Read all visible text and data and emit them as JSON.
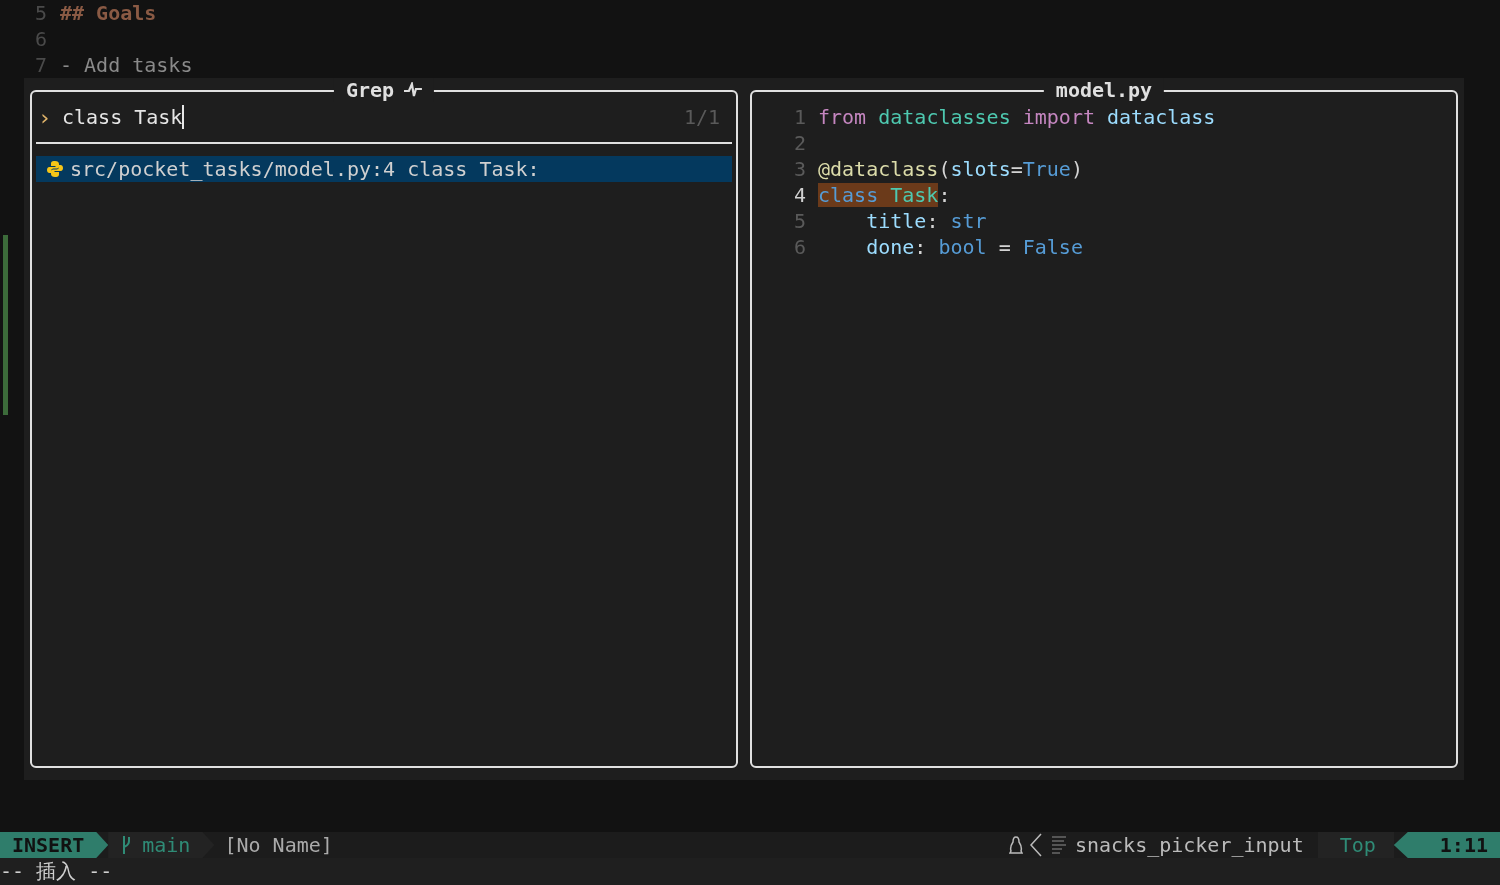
{
  "editor": {
    "lines": [
      {
        "number": "5",
        "kind": "heading",
        "text": "## Goals"
      },
      {
        "number": "6"
      },
      {
        "number": "7",
        "kind": "text",
        "text": "- Add tasks"
      }
    ]
  },
  "picker": {
    "title": "Grep",
    "prompt": "›",
    "query": "class Task",
    "count": "1/1",
    "results": [
      {
        "path": "src/pocket_tasks/model.py:4",
        "text": "class Task:",
        "selected": true
      }
    ]
  },
  "preview": {
    "title": "model.py",
    "lines": [
      {
        "number": "1",
        "current": false,
        "tokens": [
          {
            "text": "from ",
            "kind": "keyword",
            "match": false
          },
          {
            "text": "dataclasses ",
            "kind": "module",
            "match": false
          },
          {
            "text": "import ",
            "kind": "keyword",
            "match": false
          },
          {
            "text": "dataclass",
            "kind": "name",
            "match": false
          }
        ]
      },
      {
        "number": "2",
        "current": false
      },
      {
        "number": "3",
        "current": false,
        "tokens": [
          {
            "text": "@dataclass",
            "kind": "decorator",
            "match": false
          },
          {
            "text": "(",
            "kind": "plain",
            "match": false
          },
          {
            "text": "slots",
            "kind": "name",
            "match": false
          },
          {
            "text": "=",
            "kind": "plain",
            "match": false
          },
          {
            "text": "True",
            "kind": "constant",
            "match": false
          },
          {
            "text": ")",
            "kind": "plain",
            "match": false
          }
        ]
      },
      {
        "number": "4",
        "current": true,
        "tokens": [
          {
            "text": "class ",
            "kind": "constant",
            "match": true
          },
          {
            "text": "Task",
            "kind": "module",
            "match": true
          },
          {
            "text": ":",
            "kind": "plain",
            "match": false
          }
        ]
      },
      {
        "number": "5",
        "current": false,
        "indent": true,
        "tokens": [
          {
            "text": "title",
            "kind": "name",
            "match": false
          },
          {
            "text": ": ",
            "kind": "plain",
            "match": false
          },
          {
            "text": "str",
            "kind": "constant",
            "match": false
          }
        ]
      },
      {
        "number": "6",
        "current": false,
        "indent": true,
        "tokens": [
          {
            "text": "done",
            "kind": "name",
            "match": false
          },
          {
            "text": ": ",
            "kind": "plain",
            "match": false
          },
          {
            "text": "bool",
            "kind": "constant",
            "match": false
          },
          {
            "text": " = ",
            "kind": "plain",
            "match": false
          },
          {
            "text": "False",
            "kind": "constant",
            "match": false
          }
        ]
      }
    ]
  },
  "status_bar": {
    "mode": "INSERT",
    "branch": "main",
    "file": "[No Name]",
    "filetype": "snacks_picker_input",
    "position": "Top",
    "cursor": "1:11"
  },
  "command_line": "-- 插入 --"
}
